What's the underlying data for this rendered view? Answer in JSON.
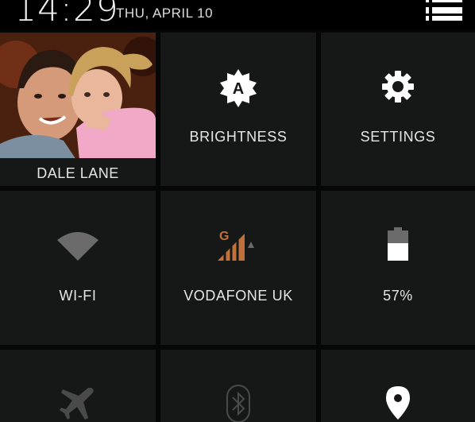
{
  "status_bar": {
    "time": "14:29",
    "date": "THU, APRIL 10"
  },
  "tiles": {
    "profile": {
      "name": "DALE LANE"
    },
    "brightness": {
      "label": "BRIGHTNESS",
      "icon": "brightness-auto-icon",
      "icon_letter": "A"
    },
    "settings": {
      "label": "SETTINGS",
      "icon": "gear-icon"
    },
    "wifi": {
      "label": "WI-FI",
      "icon": "wifi-icon"
    },
    "mobile": {
      "label": "VODAFONE UK",
      "icon": "signal-icon",
      "network_type": "G"
    },
    "battery": {
      "label": "57%",
      "icon": "battery-icon",
      "level_percent": 57
    },
    "airplane": {
      "label": "",
      "icon": "airplane-icon"
    },
    "bluetooth": {
      "label": "",
      "icon": "bluetooth-icon"
    },
    "location": {
      "label": "",
      "icon": "location-pin-icon"
    }
  },
  "colors": {
    "tile_bg": "#161817",
    "background": "#050605",
    "signal_accent": "#c0703a",
    "icon_white": "#ffffff",
    "icon_dim": "#6b6b6b"
  }
}
